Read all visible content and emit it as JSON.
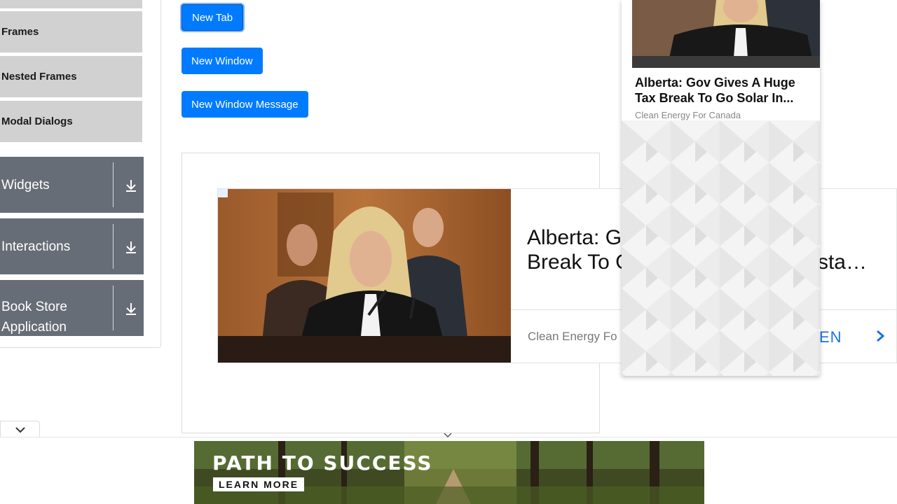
{
  "sidebar": {
    "sub_items": [
      {
        "label": ""
      },
      {
        "label": "Frames"
      },
      {
        "label": "Nested Frames"
      },
      {
        "label": "Modal Dialogs"
      }
    ],
    "groups": [
      {
        "label": "Widgets",
        "icon": "download-icon"
      },
      {
        "label": "Interactions",
        "icon": "download-icon"
      },
      {
        "label": "Book Store Application",
        "icon": "download-icon"
      }
    ]
  },
  "buttons": {
    "new_tab": "New Tab",
    "new_window": "New Window",
    "new_window_message": "New Window Message"
  },
  "ad_banner": {
    "headline": "Alberta: Gov Gives A Huge Tax Break To Go Solar In Ontario... Install on your esta…",
    "headline_line1": "Alberta: G",
    "headline_line2": "Break To G",
    "headline_tail": "sta…",
    "source": "Clean Energy Fo",
    "cta": "EN"
  },
  "float_card": {
    "title_line1": "Alberta: Gov Gives A Huge",
    "title_line2": "Tax Break To Go Solar In...",
    "source": "Clean Energy For Canada"
  },
  "bottom_ad": {
    "title": "PATH TO SUCCESS",
    "button": "LEARN MORE"
  },
  "colors": {
    "primary": "#007bff",
    "group_bg": "#676d76",
    "sub_bg": "#d1d1d1",
    "link": "#1a73e8"
  }
}
